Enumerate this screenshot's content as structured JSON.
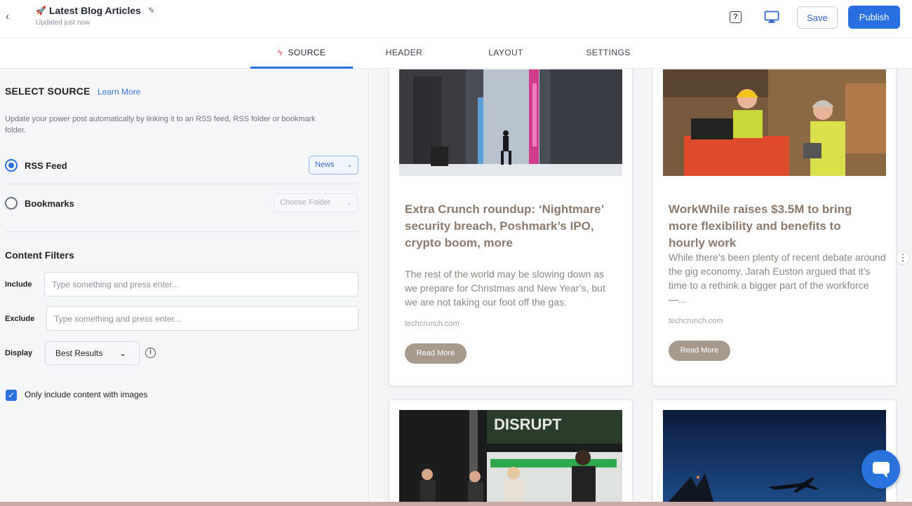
{
  "header": {
    "back_icon": "chevron-left-icon",
    "rocket_icon": "rocket-icon",
    "title": "Latest Blog Articles",
    "subtitle": "Updated just now",
    "help_icon": "?",
    "save_label": "Save",
    "publish_label": "Publish"
  },
  "tabs": [
    {
      "label": "SOURCE",
      "active": true,
      "icon": "bolt-icon"
    },
    {
      "label": "HEADER"
    },
    {
      "label": "LAYOUT"
    },
    {
      "label": "SETTINGS"
    }
  ],
  "source": {
    "heading": "SELECT SOURCE",
    "learn_more": "Learn More",
    "description": "Update your power post automatically by linking it to an RSS feed, RSS folder or bookmark folder.",
    "rss_label": "RSS Feed",
    "rss_selected": "News",
    "bookmarks_label": "Bookmarks",
    "folder_placeholder": "Choose Folder"
  },
  "filters": {
    "heading": "Content Filters",
    "include_label": "Include",
    "include_placeholder": "Type something and press enter...",
    "exclude_label": "Exclude",
    "exclude_placeholder": "Type something and press enter...",
    "display_label": "Display",
    "display_value": "Best Results",
    "images_only_label": "Only include content with images",
    "images_only_checked": true
  },
  "cards": [
    {
      "title": "Extra Crunch roundup: ‘Nightmare’ security breach, Poshmark’s IPO, crypto boom, more",
      "body": "The rest of the world may be slowing down as we prepare for Christmas and New Year’s, but we are not taking our foot off the gas.",
      "source": "techcrunch.com",
      "button": "Read More"
    },
    {
      "title": "WorkWhile raises $3.5M to bring more flexibility and benefits to hourly work",
      "body": "While there’s been plenty of recent debate around the gig economy, Jarah Euston argued that it’s time to a rethink a bigger part of the workforce —...",
      "source": "techcrunch.com",
      "button": "Read More"
    }
  ],
  "lower_card": {
    "banner_text": "DISRUPT"
  },
  "colors": {
    "accent": "#2a6fe0",
    "card_title": "#8b7a6d",
    "read_more_bg": "#a8998d"
  }
}
